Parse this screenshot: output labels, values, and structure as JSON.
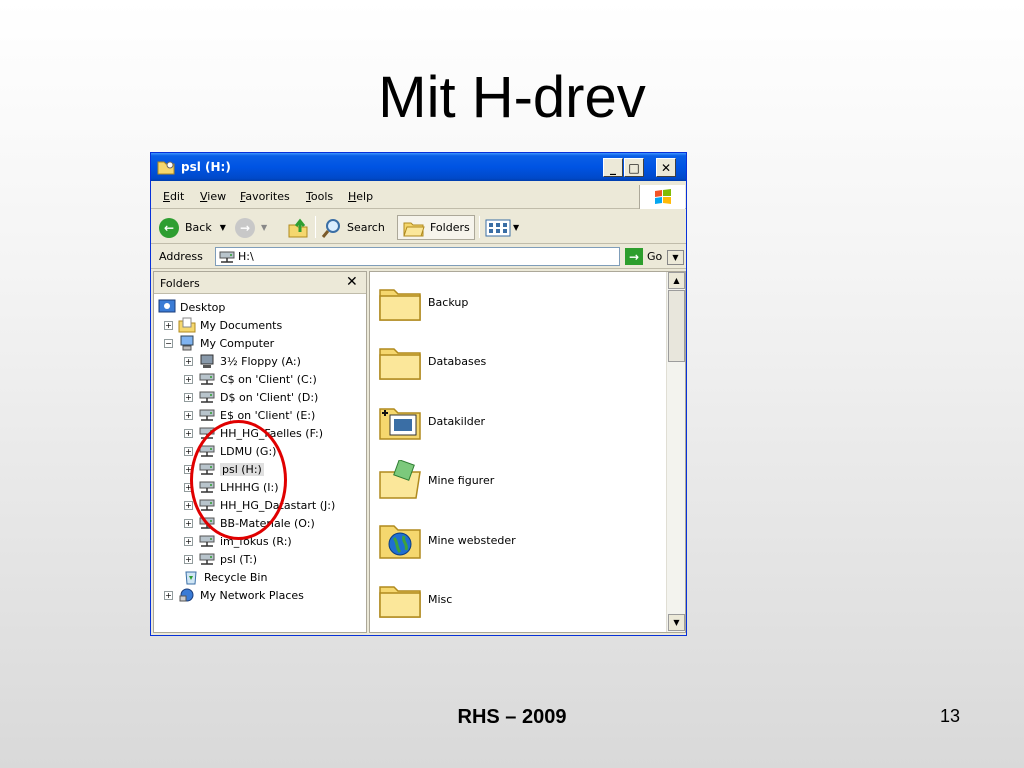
{
  "slide": {
    "title": "Mit H-drev",
    "footer_center": "RHS – 2009",
    "page_number": "13"
  },
  "window": {
    "title": "psl (H:)",
    "controls": {
      "minimize": "_",
      "maximize": "□",
      "close": "✕"
    }
  },
  "menu": [
    "Edit",
    "View",
    "Favorites",
    "Tools",
    "Help"
  ],
  "toolbar": {
    "back_label": "Back",
    "search_label": "Search",
    "folders_label": "Folders"
  },
  "address": {
    "label": "Address",
    "value": "H:\\",
    "go_label": "Go"
  },
  "folders_pane": {
    "header": "Folders",
    "close": "✕",
    "items": [
      {
        "label": "Desktop",
        "icon": "desktop-icon"
      },
      {
        "label": "My Documents",
        "icon": "documents-folder-icon"
      },
      {
        "label": "My Computer",
        "icon": "computer-icon"
      },
      {
        "label": "3½ Floppy (A:)",
        "icon": "floppy-icon"
      },
      {
        "label": "C$ on 'Client' (C:)",
        "icon": "network-drive-icon"
      },
      {
        "label": "D$ on 'Client' (D:)",
        "icon": "network-drive-icon"
      },
      {
        "label": "E$ on 'Client' (E:)",
        "icon": "network-drive-icon"
      },
      {
        "label": "HH_HG_Faelles (F:)",
        "icon": "network-drive-icon"
      },
      {
        "label": "LDMU (G:)",
        "icon": "network-drive-icon"
      },
      {
        "label": "psl (H:)",
        "icon": "network-drive-icon"
      },
      {
        "label": "LHHHG (I:)",
        "icon": "network-drive-icon"
      },
      {
        "label": "HH_HG_Datastart (J:)",
        "icon": "network-drive-icon"
      },
      {
        "label": "BB-Materiale (O:)",
        "icon": "network-drive-icon"
      },
      {
        "label": "im_fokus (R:)",
        "icon": "network-drive-icon"
      },
      {
        "label": "psl (T:)",
        "icon": "network-drive-icon"
      },
      {
        "label": "Recycle Bin",
        "icon": "recycle-bin-icon"
      },
      {
        "label": "My Network Places",
        "icon": "network-places-icon"
      }
    ]
  },
  "content": {
    "items": [
      {
        "label": "Backup",
        "icon": "folder-icon"
      },
      {
        "label": "Databases",
        "icon": "folder-icon"
      },
      {
        "label": "Datakilder",
        "icon": "data-sources-folder-icon"
      },
      {
        "label": "Mine figurer",
        "icon": "pictures-folder-icon"
      },
      {
        "label": "Mine websteder",
        "icon": "websites-folder-icon"
      },
      {
        "label": "Misc",
        "icon": "folder-icon"
      }
    ]
  },
  "colors": {
    "titlebar": "#0054e3",
    "annotation": "#e00000",
    "chrome": "#ece9d8"
  }
}
